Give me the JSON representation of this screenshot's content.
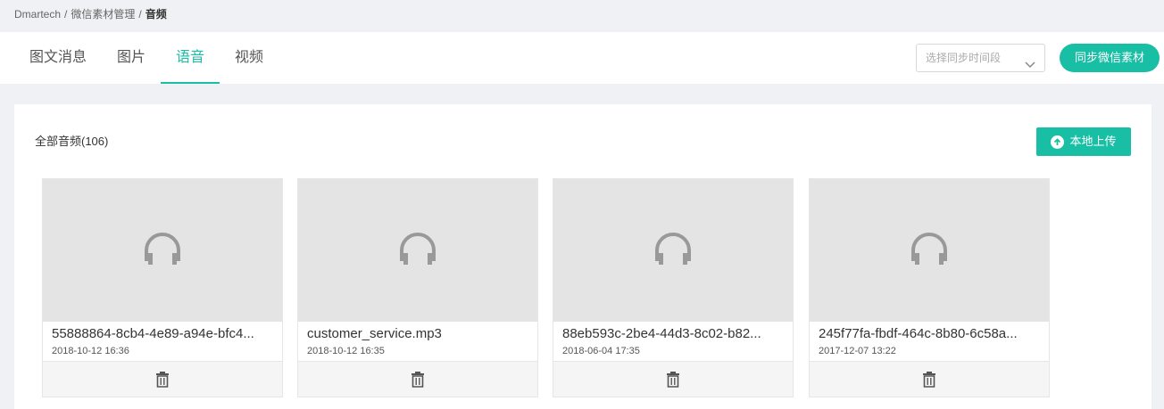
{
  "breadcrumb": {
    "items": [
      "Dmartech",
      "微信素材管理",
      "音频"
    ],
    "separator": "/"
  },
  "tabs": [
    {
      "label": "图文消息",
      "active": false
    },
    {
      "label": "图片",
      "active": false
    },
    {
      "label": "语音",
      "active": true
    },
    {
      "label": "视频",
      "active": false
    }
  ],
  "sync": {
    "select_placeholder": "选择同步时间段",
    "button_label": "同步微信素材"
  },
  "panel": {
    "title": "全部音频(106)",
    "upload_label": "本地上传"
  },
  "cards": [
    {
      "name": "55888864-8cb4-4e89-a94e-bfc4...",
      "date": "2018-10-12 16:36"
    },
    {
      "name": "customer_service.mp3",
      "date": "2018-10-12 16:35"
    },
    {
      "name": "88eb593c-2be4-44d3-8c02-b82...",
      "date": "2018-06-04 17:35"
    },
    {
      "name": "245f77fa-fbdf-464c-8b80-6c58a...",
      "date": "2017-12-07 13:22"
    }
  ],
  "colors": {
    "accent": "#19bfa5",
    "background": "#f0f1f4",
    "thumb": "#e4e4e4"
  },
  "icons": {
    "card_thumb": "headphones-icon",
    "card_action": "trash-icon",
    "select": "chevron-down-icon",
    "upload": "arrow-up-circle-icon"
  }
}
